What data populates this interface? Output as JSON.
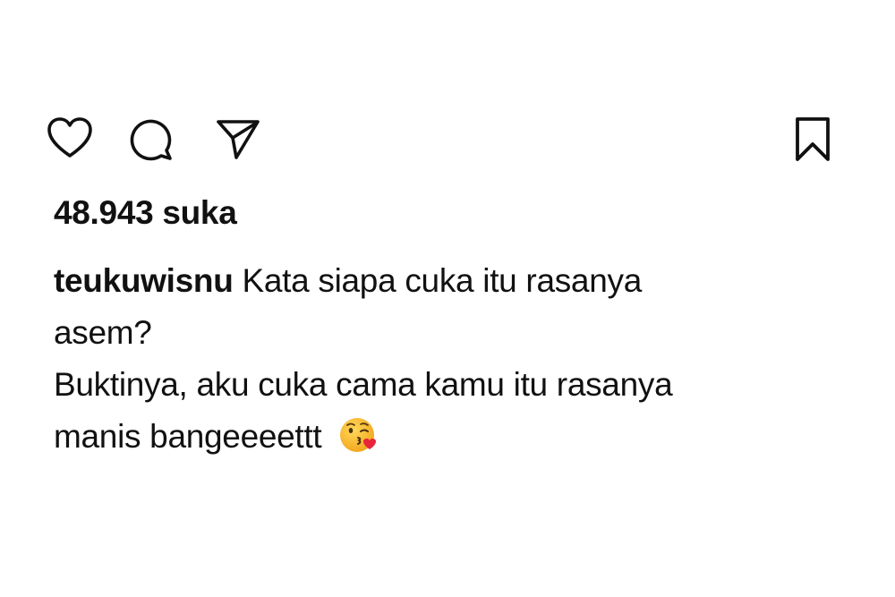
{
  "actions": {
    "like_icon": "heart-outline-icon",
    "comment_icon": "speech-bubble-icon",
    "share_icon": "paper-plane-icon",
    "save_icon": "bookmark-outline-icon"
  },
  "post": {
    "likes_text": "48.943 suka",
    "username": "teukuwisnu",
    "caption_line1": "Kata siapa cuka itu rasanya",
    "caption_line2": "asem?",
    "caption_line3": "Buktinya, aku cuka cama kamu itu rasanya",
    "caption_line4": "manis bangeeeettt",
    "emoji": "face-blowing-a-kiss"
  },
  "colors": {
    "text": "#111111",
    "background": "#ffffff",
    "emoji_face": "#f7b52c",
    "emoji_heart": "#e8253a"
  }
}
